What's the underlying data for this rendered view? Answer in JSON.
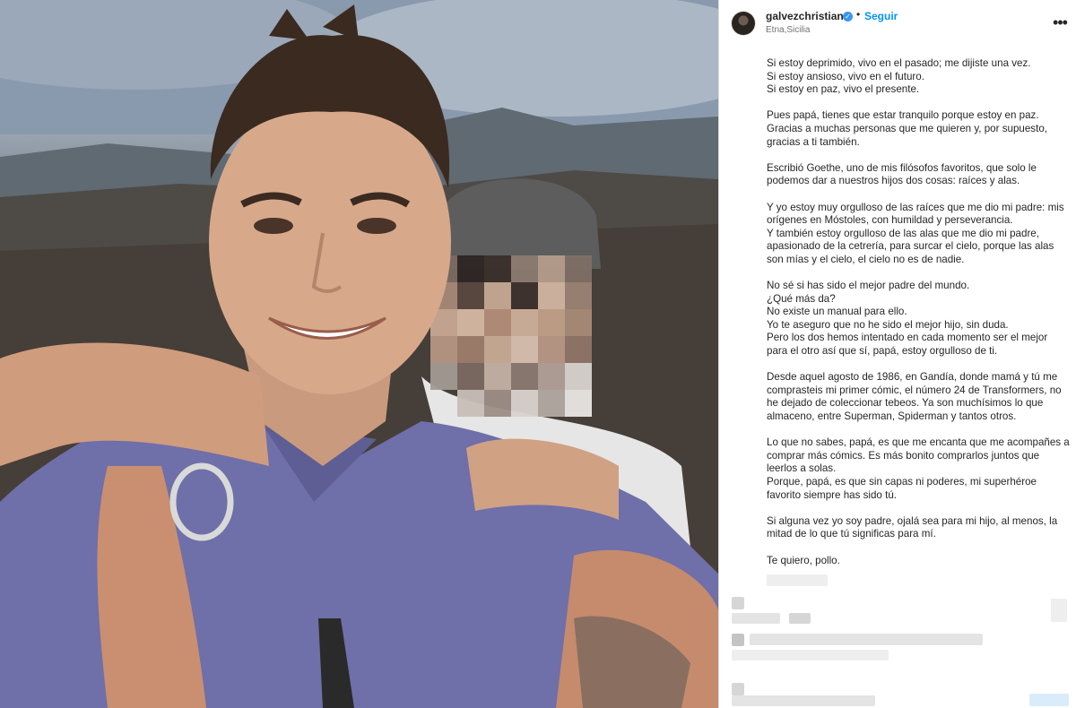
{
  "post": {
    "username": "galvezchristian",
    "follow_label": "Seguir",
    "location": "Etna,Sicilia",
    "more_label": "•••",
    "verified_icon": "✓"
  },
  "caption": {
    "paragraphs": [
      "Si estoy deprimido, vivo en el pasado; me dijiste una vez.\nSi estoy ansioso, vivo en el futuro.\nSi estoy en paz, vivo el presente.",
      "Pues papá, tienes que estar tranquilo porque estoy en paz.\nGracias a muchas personas que me quieren y, por supuesto,\ngracias a ti también.",
      "Escribió Goethe, uno de mis filósofos favoritos, que solo le\npodemos dar a nuestros hijos dos cosas: raíces y alas.",
      "Y yo estoy muy orgulloso de las raíces que me dio mi padre: mis\norígenes en Móstoles, con humildad y perseverancia.\nY también estoy orgulloso de las alas que me dio mi padre,\napasionado de la cetrería, para surcar el cielo, porque las alas\nson mías y el cielo, el cielo no es de nadie.",
      "No sé si has sido el mejor padre del mundo.\n¿Qué más da?\nNo existe un manual para ello.\nYo te aseguro que no he sido el mejor hijo, sin duda.\nPero los dos hemos intentado en cada momento ser el mejor\npara el otro así que sí, papá, estoy orgulloso de ti.",
      "Desde aquel agosto de 1986, en Gandía, donde mamá y tú me\ncomprasteis mi primer cómic, el número 24 de Transformers, no\nhe dejado de coleccionar tebeos. Ya son muchísimos lo que\nalmaceno, entre Superman, Spiderman y tantos otros.",
      "Lo que no sabes, papá, es que me encanta que me acompañes a\ncomprar más cómics. Es más bonito comprarlos juntos que\nleerlos a solas.\nPorque, papá, es que sin capas ni poderes, mi superhéroe\nfavorito siempre has sido tú.",
      "Si alguna vez yo soy padre, ojalá sea para mi hijo, al menos, la\nmitad de lo que tú significas para mí.",
      "Te quiero, pollo."
    ]
  },
  "colors": {
    "accent": "#0095f6",
    "verified": "#3897f0",
    "text": "#262626",
    "muted": "#737373",
    "border": "#dbdbdb"
  }
}
